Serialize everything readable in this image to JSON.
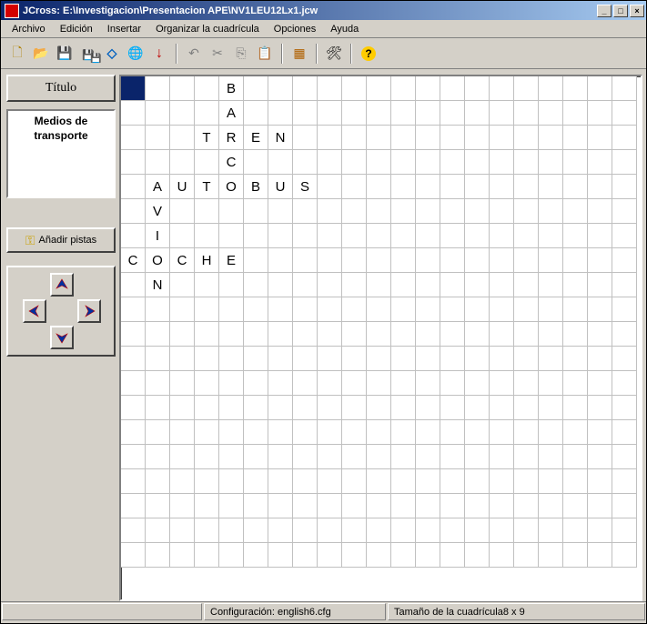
{
  "window": {
    "title": "JCross: E:\\Investigacion\\Presentacion APE\\NV1LEU12Lx1.jcw"
  },
  "menus": [
    "Archivo",
    "Edición",
    "Insertar",
    "Organizar la cuadrícula",
    "Opciones",
    "Ayuda"
  ],
  "sidebar": {
    "titulo_button": "Título",
    "title_content": "Medios de transporte",
    "add_clues": "Añadir pistas"
  },
  "status": {
    "config": "Configuración: english6.cfg",
    "size": "Tamaño de la cuadrícula8 x 9"
  },
  "grid": {
    "cols": 21,
    "rows": 20,
    "selected": {
      "r": 0,
      "c": 0
    },
    "letters": [
      {
        "r": 0,
        "c": 4,
        "ch": "B"
      },
      {
        "r": 1,
        "c": 4,
        "ch": "A"
      },
      {
        "r": 2,
        "c": 3,
        "ch": "T"
      },
      {
        "r": 2,
        "c": 4,
        "ch": "R"
      },
      {
        "r": 2,
        "c": 5,
        "ch": "E"
      },
      {
        "r": 2,
        "c": 6,
        "ch": "N"
      },
      {
        "r": 3,
        "c": 4,
        "ch": "C"
      },
      {
        "r": 4,
        "c": 1,
        "ch": "A"
      },
      {
        "r": 4,
        "c": 2,
        "ch": "U"
      },
      {
        "r": 4,
        "c": 3,
        "ch": "T"
      },
      {
        "r": 4,
        "c": 4,
        "ch": "O"
      },
      {
        "r": 4,
        "c": 5,
        "ch": "B"
      },
      {
        "r": 4,
        "c": 6,
        "ch": "U"
      },
      {
        "r": 4,
        "c": 7,
        "ch": "S"
      },
      {
        "r": 5,
        "c": 1,
        "ch": "V"
      },
      {
        "r": 6,
        "c": 1,
        "ch": "I"
      },
      {
        "r": 7,
        "c": 0,
        "ch": "C"
      },
      {
        "r": 7,
        "c": 1,
        "ch": "O"
      },
      {
        "r": 7,
        "c": 2,
        "ch": "C"
      },
      {
        "r": 7,
        "c": 3,
        "ch": "H"
      },
      {
        "r": 7,
        "c": 4,
        "ch": "E"
      },
      {
        "r": 8,
        "c": 1,
        "ch": "N"
      }
    ]
  },
  "chart_data": {
    "type": "table",
    "title": "Crossword grid 8 x 9",
    "words": [
      {
        "word": "BARCO",
        "dir": "down",
        "row": 0,
        "col": 4
      },
      {
        "word": "TREN",
        "dir": "across",
        "row": 2,
        "col": 3
      },
      {
        "word": "AUTOBUS",
        "dir": "across",
        "row": 4,
        "col": 1
      },
      {
        "word": "AVION",
        "dir": "down",
        "row": 4,
        "col": 1
      },
      {
        "word": "COCHE",
        "dir": "across",
        "row": 7,
        "col": 0
      }
    ]
  }
}
